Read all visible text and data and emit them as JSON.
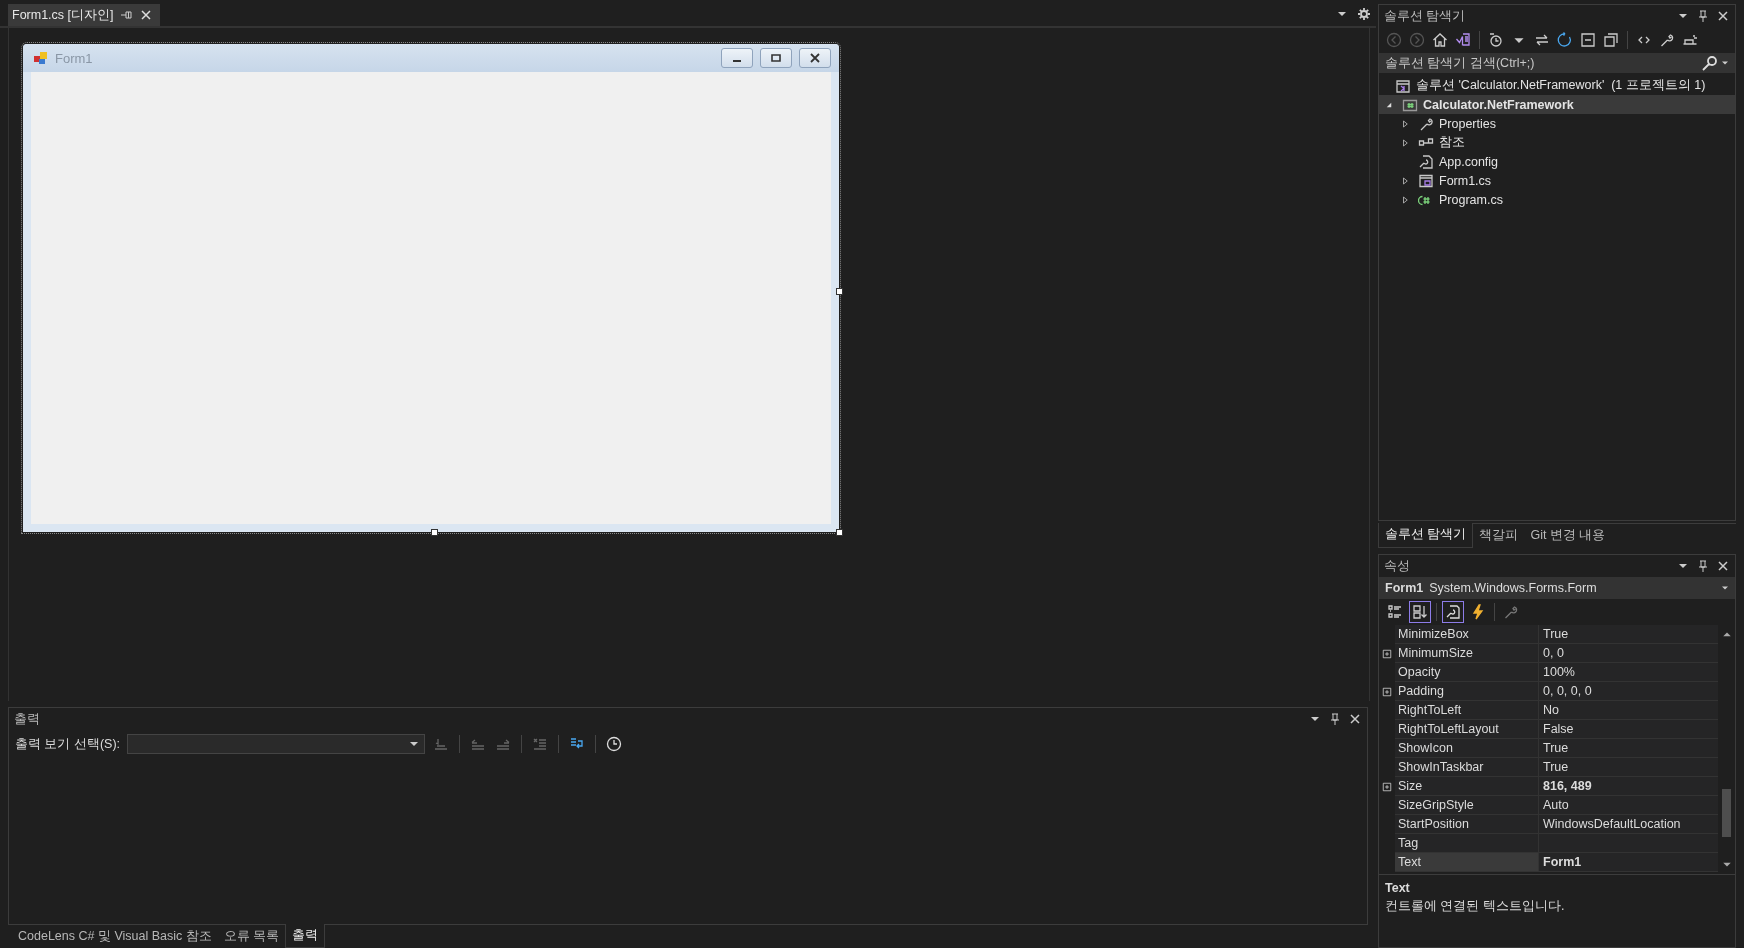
{
  "document_tab": {
    "label": "Form1.cs [디자인]",
    "selected": true
  },
  "form": {
    "title": "Form1"
  },
  "output": {
    "title": "출력",
    "source_label": "출력 보기 선택(S):"
  },
  "bottom_tabs": [
    {
      "label": "CodeLens C# 및 Visual Basic 참조",
      "selected": false
    },
    {
      "label": "오류 목록",
      "selected": false
    },
    {
      "label": "출력",
      "selected": true
    }
  ],
  "solution_explorer": {
    "title": "솔루션 탐색기",
    "search": {
      "placeholder": "솔루션 탐색기 검색(Ctrl+;)"
    },
    "tree": [
      {
        "label": "솔루션 'Calculator.NetFramework'  (1 프로젝트의 1)",
        "kind": "solution",
        "selected": false,
        "children": [
          {
            "label": "Calculator.NetFramework",
            "kind": "project",
            "selected": true,
            "expanded": true,
            "children": [
              {
                "label": "Properties",
                "kind": "properties",
                "selected": false,
                "expanded": false
              },
              {
                "label": "참조",
                "kind": "references",
                "selected": false,
                "expanded": false
              },
              {
                "label": "App.config",
                "kind": "config",
                "selected": false
              },
              {
                "label": "Form1.cs",
                "kind": "form",
                "selected": false,
                "expanded": false
              },
              {
                "label": "Program.cs",
                "kind": "csharp",
                "selected": false,
                "expanded": false
              }
            ]
          }
        ]
      }
    ]
  },
  "side_tabs": [
    {
      "label": "솔루션 탐색기",
      "selected": true
    },
    {
      "label": "책갈피",
      "selected": false
    },
    {
      "label": "Git 변경 내용",
      "selected": false
    }
  ],
  "properties": {
    "title": "속성",
    "object_name": "Form1",
    "object_type": "System.Windows.Forms.Form",
    "toolbar": [
      {
        "kind": "categorized",
        "selected": false
      },
      {
        "kind": "alphabetical",
        "selected": true
      },
      {
        "kind": "properties",
        "selected": true
      },
      {
        "kind": "events",
        "selected": false
      },
      {
        "kind": "property_pages",
        "selected": false
      }
    ],
    "rows": [
      {
        "name": "MinimizeBox",
        "value": "True",
        "expandable": false,
        "modified": false,
        "selected": false
      },
      {
        "name": "MinimumSize",
        "value": "0, 0",
        "expandable": true,
        "modified": false,
        "selected": false
      },
      {
        "name": "Opacity",
        "value": "100%",
        "expandable": false,
        "modified": false,
        "selected": false
      },
      {
        "name": "Padding",
        "value": "0, 0, 0, 0",
        "expandable": true,
        "modified": false,
        "selected": false
      },
      {
        "name": "RightToLeft",
        "value": "No",
        "expandable": false,
        "modified": false,
        "selected": false
      },
      {
        "name": "RightToLeftLayout",
        "value": "False",
        "expandable": false,
        "modified": false,
        "selected": false
      },
      {
        "name": "ShowIcon",
        "value": "True",
        "expandable": false,
        "modified": false,
        "selected": false
      },
      {
        "name": "ShowInTaskbar",
        "value": "True",
        "expandable": false,
        "modified": false,
        "selected": false
      },
      {
        "name": "Size",
        "value": "816, 489",
        "expandable": true,
        "modified": true,
        "selected": false
      },
      {
        "name": "SizeGripStyle",
        "value": "Auto",
        "expandable": false,
        "modified": false,
        "selected": false
      },
      {
        "name": "StartPosition",
        "value": "WindowsDefaultLocation",
        "expandable": false,
        "modified": false,
        "selected": false
      },
      {
        "name": "Tag",
        "expandable": false,
        "selected": false
      },
      {
        "name": "Text",
        "value": "Form1",
        "expandable": false,
        "modified": true,
        "selected": true
      }
    ],
    "description": {
      "title": "Text",
      "text": "컨트롤에 연결된 텍스트입니다."
    }
  }
}
